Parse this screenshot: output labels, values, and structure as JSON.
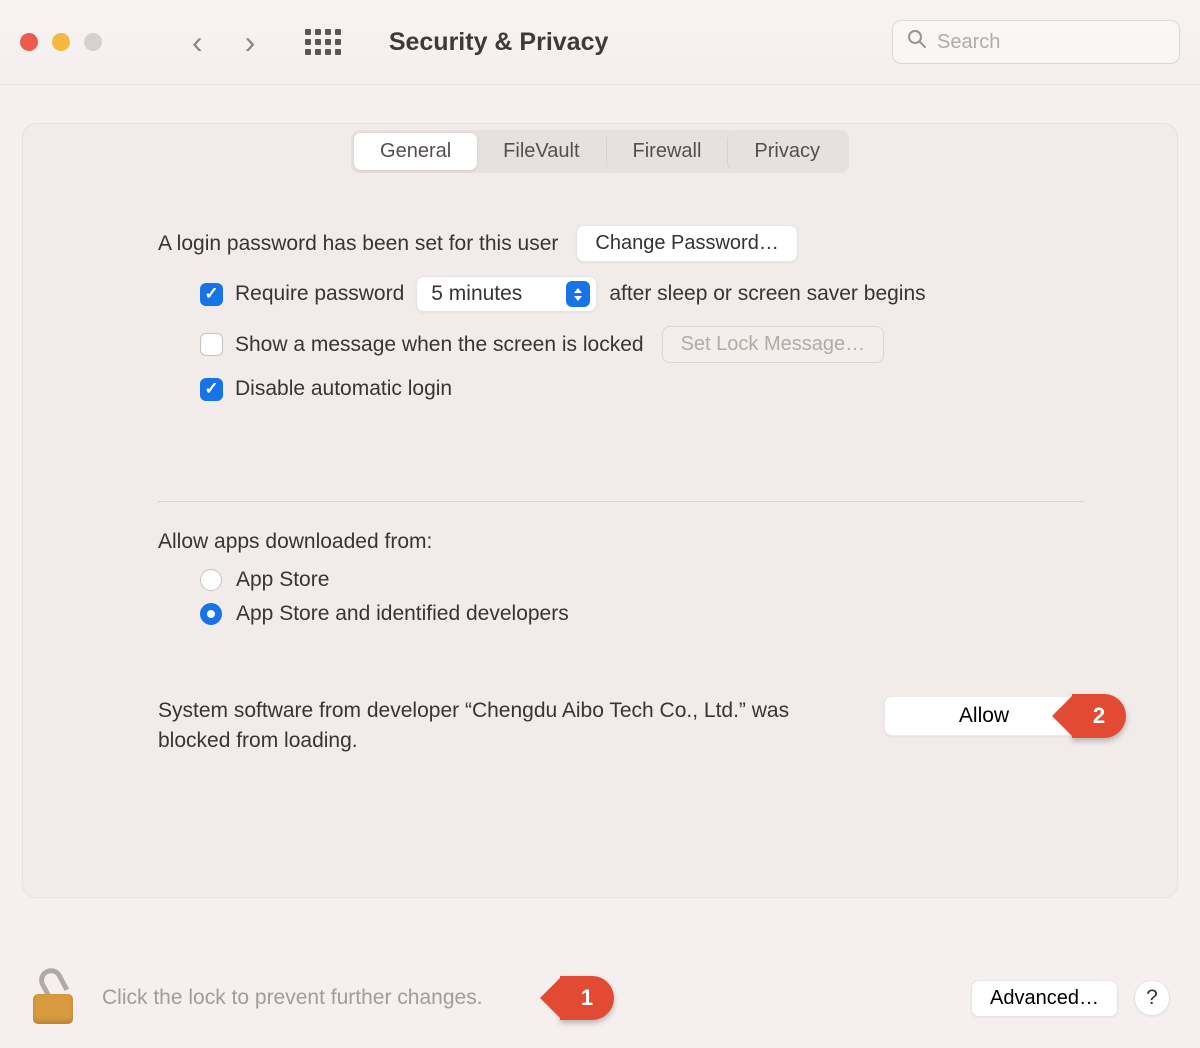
{
  "window": {
    "title": "Security & Privacy"
  },
  "search": {
    "placeholder": "Search"
  },
  "tabs": [
    {
      "label": "General",
      "active": true
    },
    {
      "label": "FileVault",
      "active": false
    },
    {
      "label": "Firewall",
      "active": false
    },
    {
      "label": "Privacy",
      "active": false
    }
  ],
  "login": {
    "password_set_text": "A login password has been set for this user",
    "change_password_label": "Change Password…",
    "require_password": {
      "checked": true,
      "prefix": "Require password",
      "delay": "5 minutes",
      "suffix": "after sleep or screen saver begins"
    },
    "show_message": {
      "checked": false,
      "label": "Show a message when the screen is locked",
      "set_lock_label": "Set Lock Message…"
    },
    "disable_auto_login": {
      "checked": true,
      "label": "Disable automatic login"
    }
  },
  "allow_apps": {
    "heading": "Allow apps downloaded from:",
    "options": [
      {
        "label": "App Store",
        "selected": false
      },
      {
        "label": "App Store and identified developers",
        "selected": true
      }
    ]
  },
  "blocked": {
    "message": "System software from developer “Chengdu Aibo Tech Co., Ltd.” was blocked from loading.",
    "allow_label": "Allow"
  },
  "footer": {
    "lock_text": "Click the lock to prevent further changes.",
    "advanced_label": "Advanced…",
    "help_label": "?"
  },
  "annotations": {
    "one": "1",
    "two": "2"
  }
}
